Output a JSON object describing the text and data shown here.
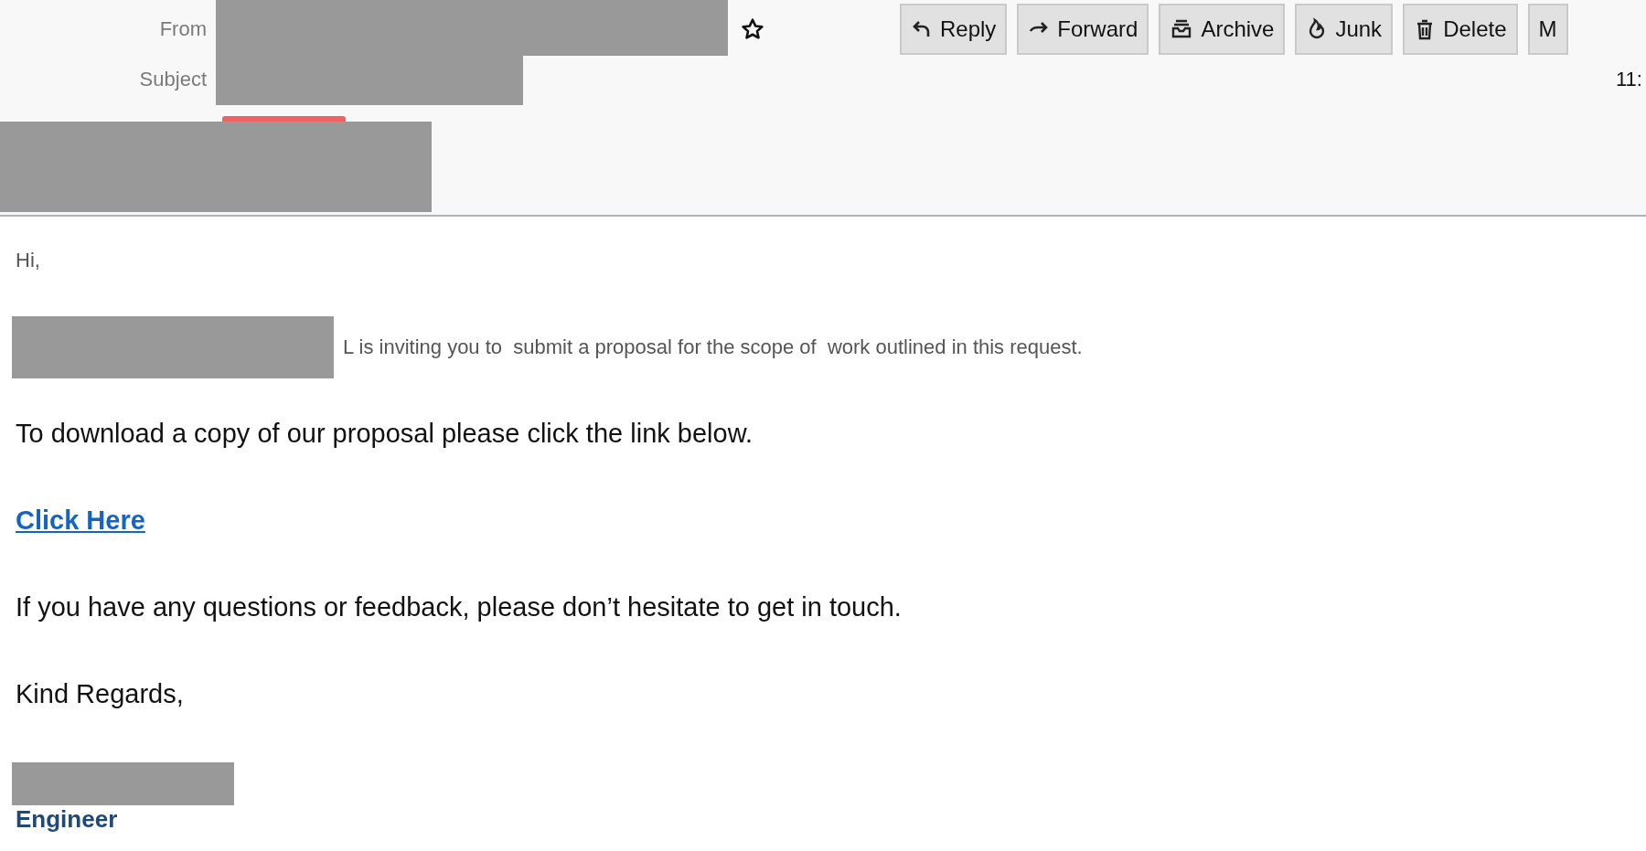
{
  "header": {
    "from_label": "From",
    "subject_label": "Subject",
    "starred": false,
    "time": "11:",
    "toolbar": [
      {
        "label": "Reply",
        "kind": "reply"
      },
      {
        "label": "Forward",
        "kind": "forward"
      },
      {
        "label": "Archive",
        "kind": "archive"
      },
      {
        "label": "Junk",
        "kind": "junk"
      },
      {
        "label": "Delete",
        "kind": "delete"
      },
      {
        "label": "M",
        "kind": "plain"
      }
    ]
  },
  "body": [
    {
      "kind": "small",
      "text": "Hi,"
    },
    {
      "kind": "redacted_small",
      "text": "L is inviting you to  submit a proposal for the scope of  work outlined in this request."
    },
    {
      "kind": "text",
      "text": "To download a copy of our proposal please click the link below."
    },
    {
      "kind": "link",
      "text": "Click Here"
    },
    {
      "kind": "text",
      "text": "If you have any questions or feedback, please don’t hesitate to get in touch."
    },
    {
      "kind": "text",
      "text": "Kind Regards,"
    },
    {
      "kind": "signature_title",
      "text": "Engineer"
    }
  ]
}
